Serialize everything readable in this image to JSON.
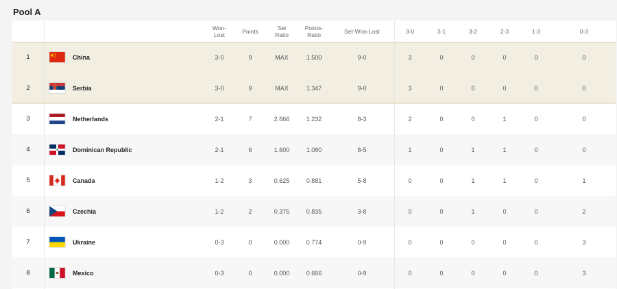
{
  "pool": {
    "title": "Pool A"
  },
  "columns": {
    "won_lost": "Won-\nLost",
    "points": "Points",
    "set_ratio": "Set\nRatio",
    "points_ratio": "Points-\nRatio",
    "set_won_lost": "Set-Won-Lost",
    "r30": "3-0",
    "r31": "3-1",
    "r32": "3-2",
    "r23": "2-3",
    "r13": "1-3",
    "r03": "0-3"
  },
  "rows": [
    {
      "rank": "1",
      "team": "China",
      "flag": "china-flag-icon",
      "won_lost": "3-0",
      "points": "9",
      "set_ratio": "MAX",
      "points_ratio": "1.500",
      "set_won_lost": "9-0",
      "r30": "3",
      "r31": "0",
      "r32": "0",
      "r23": "0",
      "r13": "0",
      "r03": "0"
    },
    {
      "rank": "2",
      "team": "Serbia",
      "flag": "serbia-flag-icon",
      "won_lost": "3-0",
      "points": "9",
      "set_ratio": "MAX",
      "points_ratio": "1.347",
      "set_won_lost": "9-0",
      "r30": "3",
      "r31": "0",
      "r32": "0",
      "r23": "0",
      "r13": "0",
      "r03": "0"
    },
    {
      "rank": "3",
      "team": "Netherlands",
      "flag": "netherlands-flag-icon",
      "won_lost": "2-1",
      "points": "7",
      "set_ratio": "2.666",
      "points_ratio": "1.232",
      "set_won_lost": "8-3",
      "r30": "2",
      "r31": "0",
      "r32": "0",
      "r23": "1",
      "r13": "0",
      "r03": "0"
    },
    {
      "rank": "4",
      "team": "Dominican Republic",
      "flag": "dominican-republic-flag-icon",
      "won_lost": "2-1",
      "points": "6",
      "set_ratio": "1.600",
      "points_ratio": "1.080",
      "set_won_lost": "8-5",
      "r30": "1",
      "r31": "0",
      "r32": "1",
      "r23": "1",
      "r13": "0",
      "r03": "0"
    },
    {
      "rank": "5",
      "team": "Canada",
      "flag": "canada-flag-icon",
      "won_lost": "1-2",
      "points": "3",
      "set_ratio": "0.625",
      "points_ratio": "0.881",
      "set_won_lost": "5-8",
      "r30": "0",
      "r31": "0",
      "r32": "1",
      "r23": "1",
      "r13": "0",
      "r03": "1"
    },
    {
      "rank": "6",
      "team": "Czechia",
      "flag": "czechia-flag-icon",
      "won_lost": "1-2",
      "points": "2",
      "set_ratio": "0.375",
      "points_ratio": "0.835",
      "set_won_lost": "3-8",
      "r30": "0",
      "r31": "0",
      "r32": "1",
      "r23": "0",
      "r13": "0",
      "r03": "2"
    },
    {
      "rank": "7",
      "team": "Ukraine",
      "flag": "ukraine-flag-icon",
      "won_lost": "0-3",
      "points": "0",
      "set_ratio": "0.000",
      "points_ratio": "0.774",
      "set_won_lost": "0-9",
      "r30": "0",
      "r31": "0",
      "r32": "0",
      "r23": "0",
      "r13": "0",
      "r03": "3"
    },
    {
      "rank": "8",
      "team": "Mexico",
      "flag": "mexico-flag-icon",
      "won_lost": "0-3",
      "points": "0",
      "set_ratio": "0.000",
      "points_ratio": "0.666",
      "set_won_lost": "0-9",
      "r30": "0",
      "r31": "0",
      "r32": "0",
      "r23": "0",
      "r13": "0",
      "r03": "3"
    }
  ]
}
